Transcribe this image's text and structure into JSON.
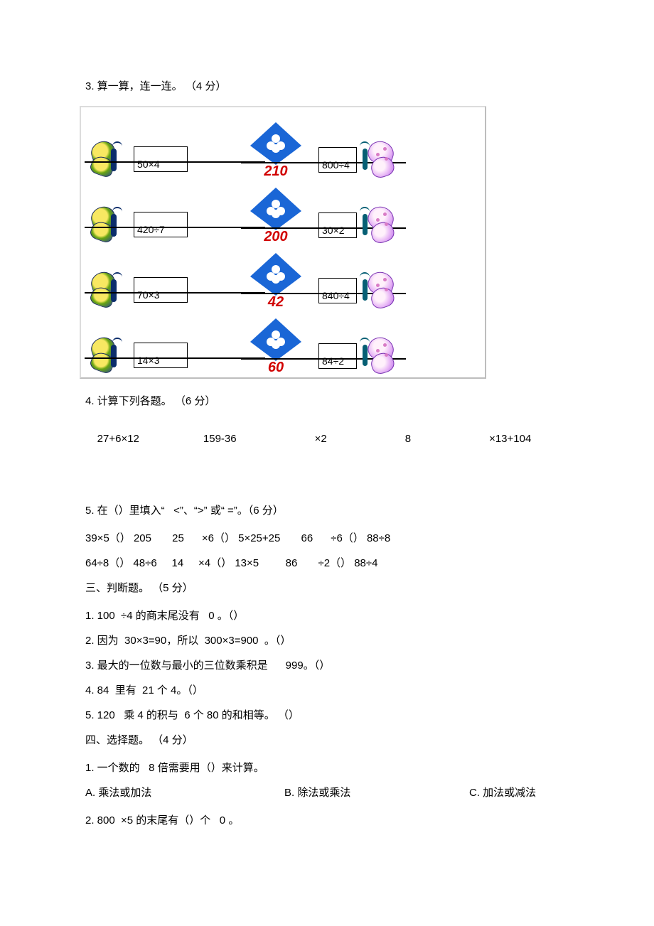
{
  "q3": {
    "title": "3. 算一算，连一连。 （4 分）"
  },
  "match": {
    "left": [
      "50×4",
      "420÷7",
      "70×3",
      "14×3"
    ],
    "mid": [
      "210",
      "200",
      "42",
      "60"
    ],
    "right": [
      "800÷4",
      "30×2",
      "840÷4",
      "84÷2"
    ]
  },
  "q4": {
    "title": "4. 计算下列各题。 （6 分）",
    "parts": [
      "27+6×12",
      "159-36",
      "×2",
      "8",
      "×13+104"
    ]
  },
  "q5": {
    "title": "5. 在（）里填入“   <”、“>” 或“ =”。（6 分）",
    "line1": "39×5（） 205       25      ×6（） 5×25+25       66      ÷6（） 88÷8",
    "line2": "64÷8（） 48÷6     14     ×4（） 13×5         86       ÷2（） 88÷4"
  },
  "s3": {
    "title": "三、判断题。 （5 分）",
    "items": [
      "1. 100  ÷4 的商末尾没有   0 。（）",
      "2. 因为  30×3=90，所以  300×3=900  。（）",
      "3. 最大的一位数与最小的三位数乘积是      999。（）",
      "4. 84  里有  21 个 4。（）",
      "5. 120   乘 4 的积与  6 个 80 的和相等。 （）"
    ]
  },
  "s4": {
    "title": "四、选择题。 （4 分）",
    "q1": "1. 一个数的   8 倍需要用（）来计算。",
    "q1opts": [
      "A. 乘法或加法",
      "B. 除法或乘法",
      "C. 加法或减法"
    ],
    "q2": "2. 800  ×5 的末尾有（）个   0 。"
  }
}
